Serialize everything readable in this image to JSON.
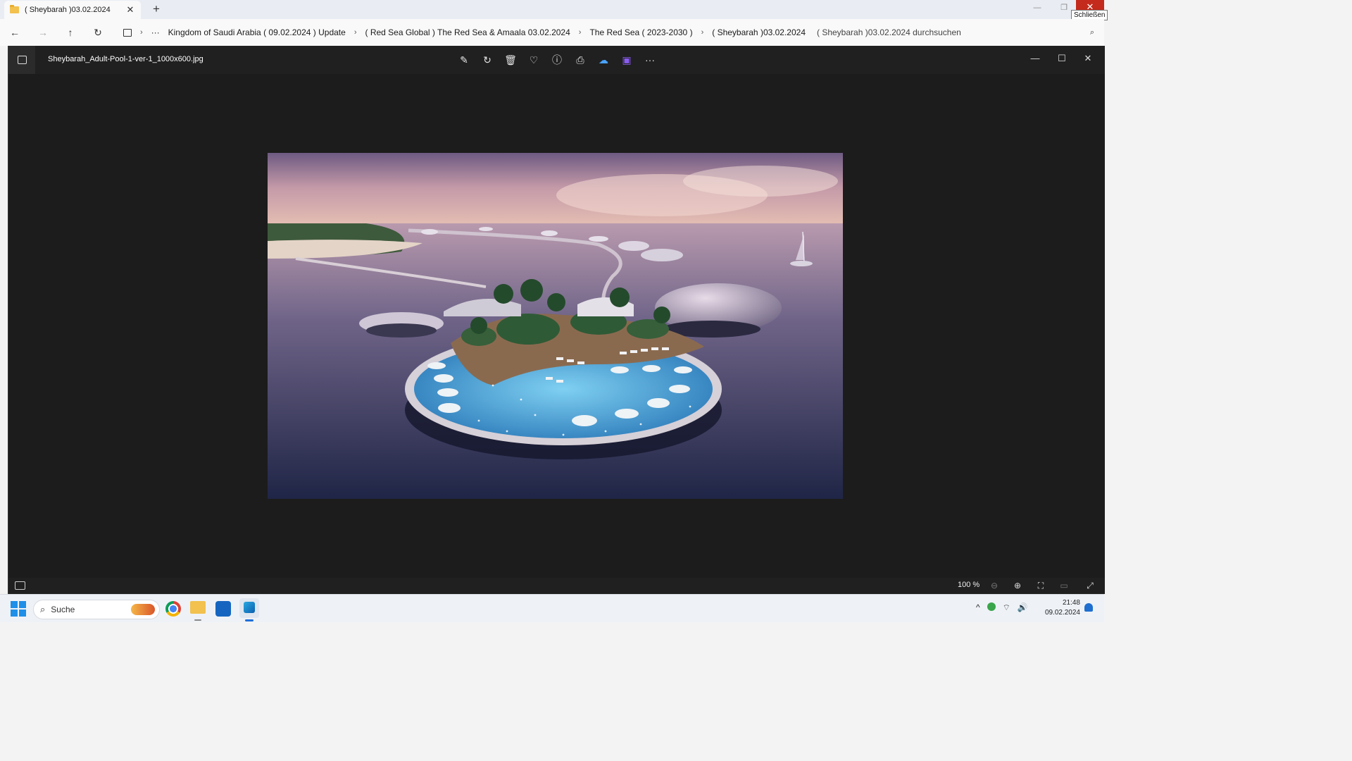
{
  "explorer": {
    "tab_title": "( Sheybarah )03.02.2024",
    "tab_close": "✕",
    "new_tab": "+",
    "window_controls": {
      "minimize": "—",
      "restore": "❐",
      "close": "✕"
    },
    "close_tooltip": "Schließen",
    "nav": {
      "back": "←",
      "forward": "→",
      "up": "↑",
      "refresh": "↻",
      "more": "···"
    },
    "breadcrumbs": [
      "Kingdom of Saudi Arabia ( 09.02.2024 ) Update",
      "( Red Sea Global ) The Red Sea & Amaala 03.02.2024",
      "The Red Sea ( 2023-2030 )",
      "( Sheybarah )03.02.2024"
    ],
    "search_placeholder": "( Sheybarah )03.02.2024 durchsuchen"
  },
  "viewer": {
    "filename": "Sheybarah_Adult-Pool-1-ver-1_1000x600.jpg",
    "toolbar_icons": [
      "edit-icon",
      "rotate-icon",
      "delete-icon",
      "favorite-icon",
      "info-icon",
      "print-icon",
      "onedrive-icon",
      "clipchamp-icon",
      "more-icon"
    ],
    "toolbar_glyphs": [
      "✎",
      "↻",
      "🗑",
      "♡",
      "ⓘ",
      "⎙",
      "☁",
      "▣",
      "···"
    ],
    "window_controls": {
      "minimize": "—",
      "maximize": "☐",
      "close": "✕"
    },
    "zoom": "100 %",
    "zoom_out": "⊖",
    "zoom_in": "⊕",
    "fit": "⛶",
    "actual_size": "▭",
    "fullscreen": "⤢"
  },
  "taskbar": {
    "search_label": "Suche",
    "search_icon": "⌕",
    "tray": {
      "chevron": "^",
      "wifi": "⌔",
      "volume": "🔊"
    },
    "time": "21:48",
    "date": "09.02.2024"
  },
  "colors": {
    "viewer_bg": "#1c1c1c",
    "close_red": "#c42b1c",
    "accent": "#1f8fe8"
  }
}
